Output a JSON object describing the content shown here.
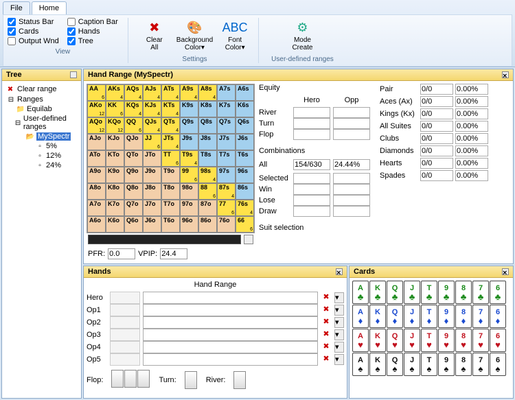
{
  "ribbon": {
    "tabs": [
      "File",
      "Home"
    ],
    "active_tab": 1,
    "view": {
      "checks": [
        {
          "label": "Status Bar",
          "checked": true
        },
        {
          "label": "Caption Bar",
          "checked": false
        },
        {
          "label": "Cards",
          "checked": true
        },
        {
          "label": "Hands",
          "checked": true
        },
        {
          "label": "Output Wnd",
          "checked": false
        },
        {
          "label": "Tree",
          "checked": true
        }
      ],
      "group_label": "View"
    },
    "settings": {
      "buttons": [
        {
          "icon": "✖",
          "label": "Clear\nAll",
          "color": "#c00"
        },
        {
          "icon": "🎨",
          "label": "Background\nColor▾"
        },
        {
          "icon": "ABC",
          "label": "Font\nColor▾",
          "color": "#06c"
        }
      ],
      "group_label": "Settings"
    },
    "udr": {
      "buttons": [
        {
          "icon": "⚙",
          "label": "Mode\nCreate",
          "color": "#2a8"
        }
      ],
      "group_label": "User-defined ranges"
    }
  },
  "tree": {
    "title": "Tree",
    "clear": "Clear range",
    "nodes": [
      {
        "indent": 0,
        "ico": "⊟",
        "label": "Ranges"
      },
      {
        "indent": 1,
        "ico": "📁",
        "label": "Equilab"
      },
      {
        "indent": 1,
        "ico": "⊟",
        "label": "User-defined ranges"
      },
      {
        "indent": 2,
        "ico": "📂",
        "label": "MySpectr",
        "selected": true
      },
      {
        "indent": 3,
        "ico": "▫",
        "label": "5%"
      },
      {
        "indent": 3,
        "ico": "▫",
        "label": "12%"
      },
      {
        "indent": 3,
        "ico": "▫",
        "label": "24%"
      }
    ]
  },
  "hand_range": {
    "title": "Hand Range (MySpectr)",
    "grid": [
      [
        {
          "t": "AA",
          "s": "6",
          "c": "y"
        },
        {
          "t": "AKs",
          "s": "4",
          "c": "y"
        },
        {
          "t": "AQs",
          "s": "4",
          "c": "y"
        },
        {
          "t": "AJs",
          "s": "4",
          "c": "y"
        },
        {
          "t": "ATs",
          "s": "4",
          "c": "y"
        },
        {
          "t": "A9s",
          "s": "4",
          "c": "y"
        },
        {
          "t": "A8s",
          "s": "4",
          "c": "y"
        },
        {
          "t": "A7s",
          "s": "",
          "c": "b"
        },
        {
          "t": "A6s",
          "s": "",
          "c": "b"
        }
      ],
      [
        {
          "t": "AKo",
          "s": "12",
          "c": "y"
        },
        {
          "t": "KK",
          "s": "6",
          "c": "y"
        },
        {
          "t": "KQs",
          "s": "4",
          "c": "y"
        },
        {
          "t": "KJs",
          "s": "4",
          "c": "y"
        },
        {
          "t": "KTs",
          "s": "4",
          "c": "y"
        },
        {
          "t": "K9s",
          "s": "",
          "c": "b"
        },
        {
          "t": "K8s",
          "s": "",
          "c": "b"
        },
        {
          "t": "K7s",
          "s": "",
          "c": "b"
        },
        {
          "t": "K6s",
          "s": "",
          "c": "b"
        }
      ],
      [
        {
          "t": "AQo",
          "s": "12",
          "c": "y"
        },
        {
          "t": "KQo",
          "s": "12",
          "c": "y"
        },
        {
          "t": "QQ",
          "s": "6",
          "c": "y"
        },
        {
          "t": "QJs",
          "s": "4",
          "c": "y"
        },
        {
          "t": "QTs",
          "s": "4",
          "c": "y"
        },
        {
          "t": "Q9s",
          "s": "",
          "c": "b"
        },
        {
          "t": "Q8s",
          "s": "",
          "c": "b"
        },
        {
          "t": "Q7s",
          "s": "",
          "c": "b"
        },
        {
          "t": "Q6s",
          "s": "",
          "c": "b"
        }
      ],
      [
        {
          "t": "AJo",
          "s": "",
          "c": "p"
        },
        {
          "t": "KJo",
          "s": "",
          "c": "p"
        },
        {
          "t": "QJo",
          "s": "",
          "c": "p"
        },
        {
          "t": "JJ",
          "s": "6",
          "c": "y"
        },
        {
          "t": "JTs",
          "s": "4",
          "c": "y"
        },
        {
          "t": "J9s",
          "s": "",
          "c": "b"
        },
        {
          "t": "J8s",
          "s": "",
          "c": "b"
        },
        {
          "t": "J7s",
          "s": "",
          "c": "b"
        },
        {
          "t": "J6s",
          "s": "",
          "c": "b"
        }
      ],
      [
        {
          "t": "ATo",
          "s": "",
          "c": "p"
        },
        {
          "t": "KTo",
          "s": "",
          "c": "p"
        },
        {
          "t": "QTo",
          "s": "",
          "c": "p"
        },
        {
          "t": "JTo",
          "s": "",
          "c": "p"
        },
        {
          "t": "TT",
          "s": "6",
          "c": "y"
        },
        {
          "t": "T9s",
          "s": "4",
          "c": "y"
        },
        {
          "t": "T8s",
          "s": "",
          "c": "b"
        },
        {
          "t": "T7s",
          "s": "",
          "c": "b"
        },
        {
          "t": "T6s",
          "s": "",
          "c": "b"
        }
      ],
      [
        {
          "t": "A9o",
          "s": "",
          "c": "p"
        },
        {
          "t": "K9o",
          "s": "",
          "c": "p"
        },
        {
          "t": "Q9o",
          "s": "",
          "c": "p"
        },
        {
          "t": "J9o",
          "s": "",
          "c": "p"
        },
        {
          "t": "T9o",
          "s": "",
          "c": "p"
        },
        {
          "t": "99",
          "s": "6",
          "c": "y"
        },
        {
          "t": "98s",
          "s": "4",
          "c": "y"
        },
        {
          "t": "97s",
          "s": "",
          "c": "b"
        },
        {
          "t": "96s",
          "s": "",
          "c": "b"
        }
      ],
      [
        {
          "t": "A8o",
          "s": "",
          "c": "p"
        },
        {
          "t": "K8o",
          "s": "",
          "c": "p"
        },
        {
          "t": "Q8o",
          "s": "",
          "c": "p"
        },
        {
          "t": "J8o",
          "s": "",
          "c": "p"
        },
        {
          "t": "T8o",
          "s": "",
          "c": "p"
        },
        {
          "t": "98o",
          "s": "",
          "c": "p"
        },
        {
          "t": "88",
          "s": "6",
          "c": "y"
        },
        {
          "t": "87s",
          "s": "4",
          "c": "y"
        },
        {
          "t": "86s",
          "s": "",
          "c": "b"
        }
      ],
      [
        {
          "t": "A7o",
          "s": "",
          "c": "p"
        },
        {
          "t": "K7o",
          "s": "",
          "c": "p"
        },
        {
          "t": "Q7o",
          "s": "",
          "c": "p"
        },
        {
          "t": "J7o",
          "s": "",
          "c": "p"
        },
        {
          "t": "T7o",
          "s": "",
          "c": "p"
        },
        {
          "t": "97o",
          "s": "",
          "c": "p"
        },
        {
          "t": "87o",
          "s": "",
          "c": "p"
        },
        {
          "t": "77",
          "s": "6",
          "c": "y"
        },
        {
          "t": "76s",
          "s": "4",
          "c": "y"
        }
      ],
      [
        {
          "t": "A6o",
          "s": "",
          "c": "p"
        },
        {
          "t": "K6o",
          "s": "",
          "c": "p"
        },
        {
          "t": "Q6o",
          "s": "",
          "c": "p"
        },
        {
          "t": "J6o",
          "s": "",
          "c": "p"
        },
        {
          "t": "T6o",
          "s": "",
          "c": "p"
        },
        {
          "t": "96o",
          "s": "",
          "c": "p"
        },
        {
          "t": "86o",
          "s": "",
          "c": "p"
        },
        {
          "t": "76o",
          "s": "",
          "c": "p"
        },
        {
          "t": "66",
          "s": "6",
          "c": "y"
        }
      ]
    ],
    "pfr_label": "PFR:",
    "pfr": "0.0",
    "vpip_label": "VPIP:",
    "vpip": "24.4"
  },
  "equity": {
    "title": "Equity",
    "hero": "Hero",
    "opp": "Opp",
    "rows": [
      "River",
      "Turn",
      "Flop"
    ]
  },
  "combos": {
    "title": "Combinations",
    "all": {
      "label": "All",
      "v1": "154/630",
      "v2": "24.44%"
    },
    "rows": [
      "Selected",
      "Win",
      "Lose",
      "Draw"
    ],
    "suit_sel": "Suit selection"
  },
  "stats": {
    "rows": [
      {
        "label": "Pair",
        "v1": "0/0",
        "v2": "0.00%"
      },
      {
        "label": "Aces (Ax)",
        "v1": "0/0",
        "v2": "0.00%"
      },
      {
        "label": "Kings (Kx)",
        "v1": "0/0",
        "v2": "0.00%"
      },
      {
        "label": "All Suites",
        "v1": "0/0",
        "v2": "0.00%"
      },
      {
        "label": "Clubs",
        "v1": "0/0",
        "v2": "0.00%"
      },
      {
        "label": "Diamonds",
        "v1": "0/0",
        "v2": "0.00%"
      },
      {
        "label": "Hearts",
        "v1": "0/0",
        "v2": "0.00%"
      },
      {
        "label": "Spades",
        "v1": "0/0",
        "v2": "0.00%"
      }
    ]
  },
  "hands": {
    "title": "Hands",
    "header": "Hand Range",
    "rows": [
      "Hero",
      "Op1",
      "Op2",
      "Op3",
      "Op4",
      "Op5"
    ],
    "flop": "Flop:",
    "turn": "Turn:",
    "river": "River:"
  },
  "cards": {
    "title": "Cards",
    "ranks": [
      "A",
      "K",
      "Q",
      "J",
      "T",
      "9",
      "8",
      "7",
      "6"
    ],
    "suits": [
      {
        "sym": "♣",
        "cls": "s-c"
      },
      {
        "sym": "♦",
        "cls": "s-d"
      },
      {
        "sym": "♥",
        "cls": "s-h"
      },
      {
        "sym": "♠",
        "cls": "s-s"
      }
    ]
  }
}
